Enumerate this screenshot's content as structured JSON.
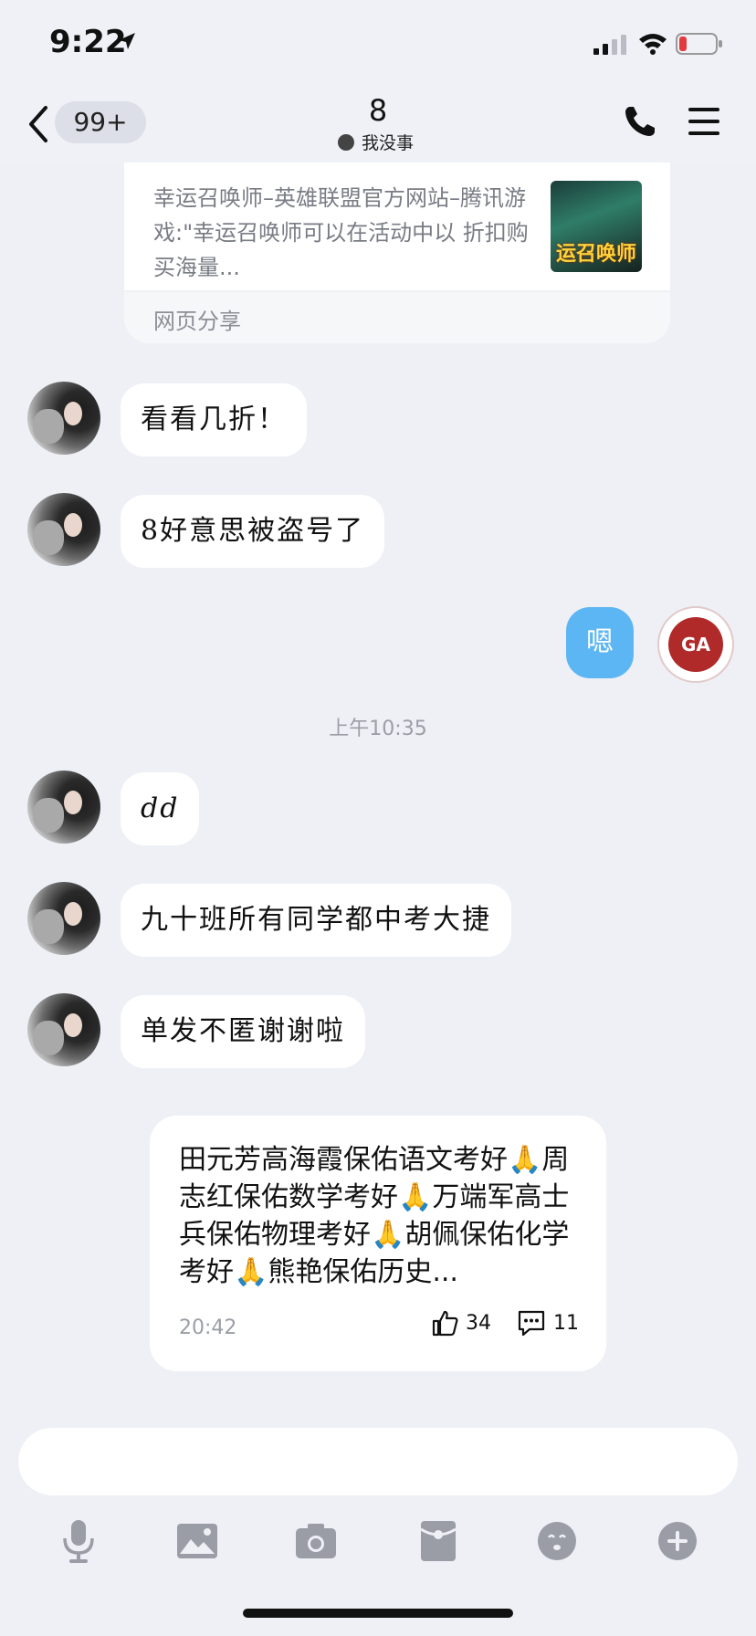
{
  "status_bar": {
    "time": "9:22"
  },
  "nav": {
    "badge": "99+",
    "title": "8",
    "status": "我没事"
  },
  "share_card": {
    "description": "幸运召唤师–英雄联盟官方网站–腾讯游戏:\"幸运召唤师可以在活动中以 折扣购买海量...",
    "thumb_text": "运召唤师",
    "footer": "网页分享"
  },
  "messages": [
    {
      "text": "看看几折！"
    },
    {
      "text": "8好意思被盗号了"
    },
    {
      "text": "嗯"
    },
    {
      "text": "dd"
    },
    {
      "text": "九十班所有同学都中考大捷"
    },
    {
      "text": "单发不匿谢谢啦"
    }
  ],
  "emblem_text": "GA",
  "time_divider": "上午10:35",
  "post": {
    "text": "田元芳高海霞保佑语文考好🙏周志红保佑数学考好🙏万端军高士兵保佑物理考好🙏胡佩保佑化学考好🙏熊艳保佑历史...",
    "time": "20:42",
    "likes": "34",
    "comments": "11"
  },
  "input": {
    "placeholder": ""
  },
  "colors": {
    "bubble_right": "#5db6f4",
    "background": "#eef0f6",
    "bubble_left": "#ffffff"
  }
}
